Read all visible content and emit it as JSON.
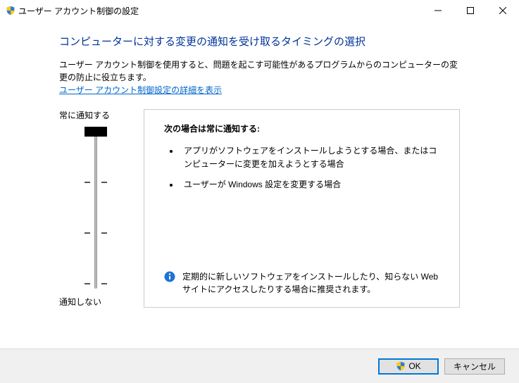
{
  "window": {
    "title": "ユーザー アカウント制御の設定"
  },
  "heading": "コンピューターに対する変更の通知を受け取るタイミングの選択",
  "description": "ユーザー アカウント制御を使用すると、問題を起こす可能性があるプログラムからのコンピューターの変更の防止に役立ちます。",
  "link_label": "ユーザー アカウント制御設定の詳細を表示",
  "slider": {
    "top_label": "常に通知する",
    "bottom_label": "通知しない",
    "position_index": 0,
    "levels": 4
  },
  "panel": {
    "title": "次の場合は常に通知する:",
    "bullets": [
      "アプリがソフトウェアをインストールしようとする場合、またはコンピューターに変更を加えようとする場合",
      "ユーザーが Windows 設定を変更する場合"
    ],
    "recommendation": "定期的に新しいソフトウェアをインストールしたり、知らない Web サイトにアクセスしたりする場合に推奨されます。"
  },
  "buttons": {
    "ok": "OK",
    "cancel": "キャンセル"
  }
}
